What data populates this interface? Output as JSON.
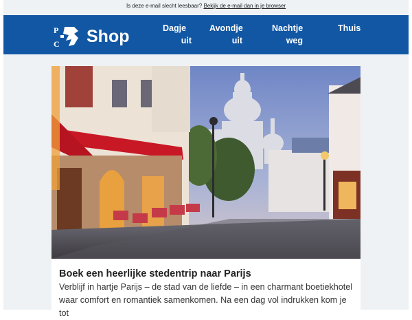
{
  "preheader": {
    "text": "Is deze e-mail slecht leesbaar?",
    "link": "Bekijk de e-mail dan in je browser"
  },
  "header": {
    "logo_text": "Shop",
    "brand_color": "#1257a4",
    "nav": [
      {
        "line1": "Dagje",
        "line2": "uit"
      },
      {
        "line1": "Avondje",
        "line2": "uit"
      },
      {
        "line1": "Nachtje",
        "line2": "weg"
      },
      {
        "line1": "Thuis",
        "line2": ""
      }
    ]
  },
  "article": {
    "headline": "Boek een heerlijke stedentrip naar Parijs",
    "body": "Verblijf in hartje Parijs – de stad van de liefde – in een charmant boetiekhotel waar comfort en romantiek samenkomen. Na een dag vol indrukken kom je tot"
  }
}
